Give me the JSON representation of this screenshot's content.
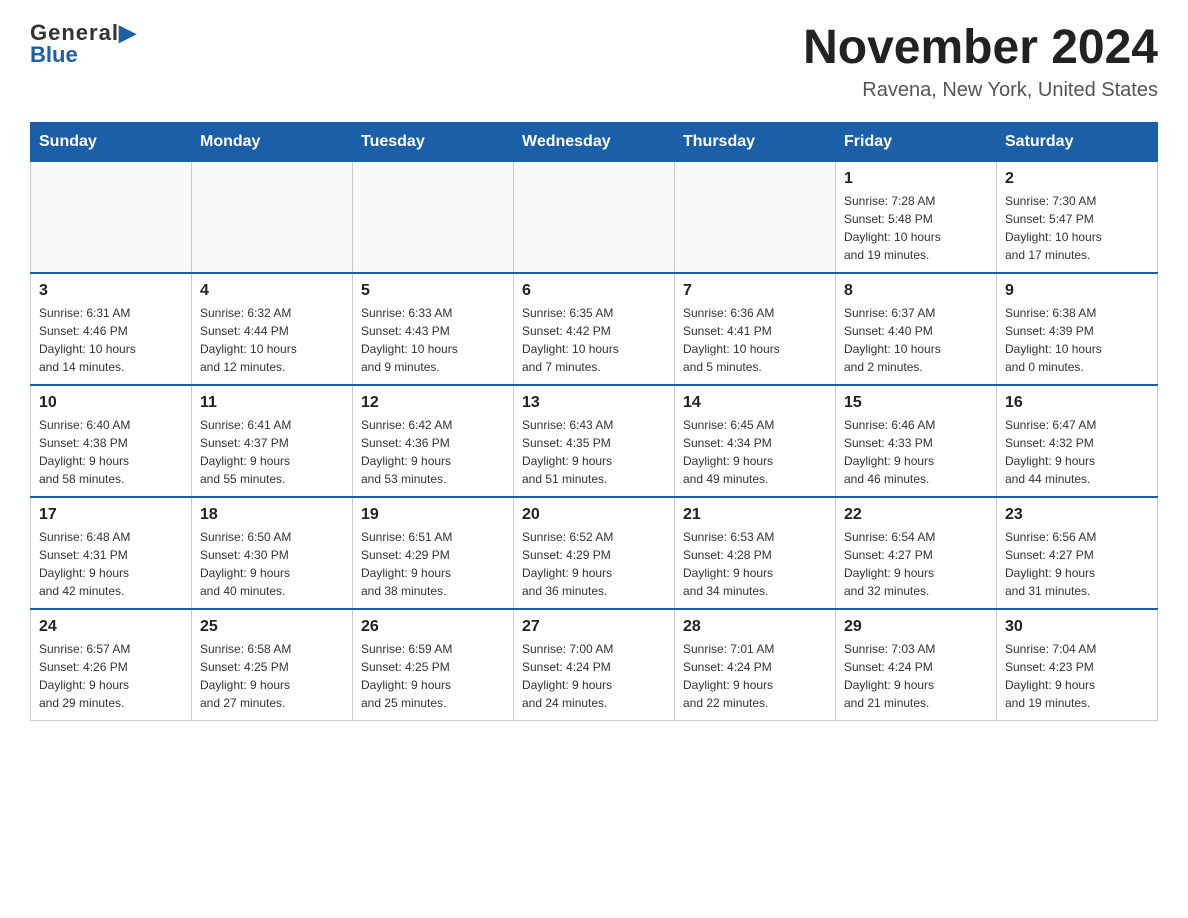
{
  "header": {
    "logo_general": "General",
    "logo_blue": "Blue",
    "month_title": "November 2024",
    "location": "Ravena, New York, United States"
  },
  "days_of_week": [
    "Sunday",
    "Monday",
    "Tuesday",
    "Wednesday",
    "Thursday",
    "Friday",
    "Saturday"
  ],
  "weeks": [
    [
      {
        "day": "",
        "info": ""
      },
      {
        "day": "",
        "info": ""
      },
      {
        "day": "",
        "info": ""
      },
      {
        "day": "",
        "info": ""
      },
      {
        "day": "",
        "info": ""
      },
      {
        "day": "1",
        "info": "Sunrise: 7:28 AM\nSunset: 5:48 PM\nDaylight: 10 hours\nand 19 minutes."
      },
      {
        "day": "2",
        "info": "Sunrise: 7:30 AM\nSunset: 5:47 PM\nDaylight: 10 hours\nand 17 minutes."
      }
    ],
    [
      {
        "day": "3",
        "info": "Sunrise: 6:31 AM\nSunset: 4:46 PM\nDaylight: 10 hours\nand 14 minutes."
      },
      {
        "day": "4",
        "info": "Sunrise: 6:32 AM\nSunset: 4:44 PM\nDaylight: 10 hours\nand 12 minutes."
      },
      {
        "day": "5",
        "info": "Sunrise: 6:33 AM\nSunset: 4:43 PM\nDaylight: 10 hours\nand 9 minutes."
      },
      {
        "day": "6",
        "info": "Sunrise: 6:35 AM\nSunset: 4:42 PM\nDaylight: 10 hours\nand 7 minutes."
      },
      {
        "day": "7",
        "info": "Sunrise: 6:36 AM\nSunset: 4:41 PM\nDaylight: 10 hours\nand 5 minutes."
      },
      {
        "day": "8",
        "info": "Sunrise: 6:37 AM\nSunset: 4:40 PM\nDaylight: 10 hours\nand 2 minutes."
      },
      {
        "day": "9",
        "info": "Sunrise: 6:38 AM\nSunset: 4:39 PM\nDaylight: 10 hours\nand 0 minutes."
      }
    ],
    [
      {
        "day": "10",
        "info": "Sunrise: 6:40 AM\nSunset: 4:38 PM\nDaylight: 9 hours\nand 58 minutes."
      },
      {
        "day": "11",
        "info": "Sunrise: 6:41 AM\nSunset: 4:37 PM\nDaylight: 9 hours\nand 55 minutes."
      },
      {
        "day": "12",
        "info": "Sunrise: 6:42 AM\nSunset: 4:36 PM\nDaylight: 9 hours\nand 53 minutes."
      },
      {
        "day": "13",
        "info": "Sunrise: 6:43 AM\nSunset: 4:35 PM\nDaylight: 9 hours\nand 51 minutes."
      },
      {
        "day": "14",
        "info": "Sunrise: 6:45 AM\nSunset: 4:34 PM\nDaylight: 9 hours\nand 49 minutes."
      },
      {
        "day": "15",
        "info": "Sunrise: 6:46 AM\nSunset: 4:33 PM\nDaylight: 9 hours\nand 46 minutes."
      },
      {
        "day": "16",
        "info": "Sunrise: 6:47 AM\nSunset: 4:32 PM\nDaylight: 9 hours\nand 44 minutes."
      }
    ],
    [
      {
        "day": "17",
        "info": "Sunrise: 6:48 AM\nSunset: 4:31 PM\nDaylight: 9 hours\nand 42 minutes."
      },
      {
        "day": "18",
        "info": "Sunrise: 6:50 AM\nSunset: 4:30 PM\nDaylight: 9 hours\nand 40 minutes."
      },
      {
        "day": "19",
        "info": "Sunrise: 6:51 AM\nSunset: 4:29 PM\nDaylight: 9 hours\nand 38 minutes."
      },
      {
        "day": "20",
        "info": "Sunrise: 6:52 AM\nSunset: 4:29 PM\nDaylight: 9 hours\nand 36 minutes."
      },
      {
        "day": "21",
        "info": "Sunrise: 6:53 AM\nSunset: 4:28 PM\nDaylight: 9 hours\nand 34 minutes."
      },
      {
        "day": "22",
        "info": "Sunrise: 6:54 AM\nSunset: 4:27 PM\nDaylight: 9 hours\nand 32 minutes."
      },
      {
        "day": "23",
        "info": "Sunrise: 6:56 AM\nSunset: 4:27 PM\nDaylight: 9 hours\nand 31 minutes."
      }
    ],
    [
      {
        "day": "24",
        "info": "Sunrise: 6:57 AM\nSunset: 4:26 PM\nDaylight: 9 hours\nand 29 minutes."
      },
      {
        "day": "25",
        "info": "Sunrise: 6:58 AM\nSunset: 4:25 PM\nDaylight: 9 hours\nand 27 minutes."
      },
      {
        "day": "26",
        "info": "Sunrise: 6:59 AM\nSunset: 4:25 PM\nDaylight: 9 hours\nand 25 minutes."
      },
      {
        "day": "27",
        "info": "Sunrise: 7:00 AM\nSunset: 4:24 PM\nDaylight: 9 hours\nand 24 minutes."
      },
      {
        "day": "28",
        "info": "Sunrise: 7:01 AM\nSunset: 4:24 PM\nDaylight: 9 hours\nand 22 minutes."
      },
      {
        "day": "29",
        "info": "Sunrise: 7:03 AM\nSunset: 4:24 PM\nDaylight: 9 hours\nand 21 minutes."
      },
      {
        "day": "30",
        "info": "Sunrise: 7:04 AM\nSunset: 4:23 PM\nDaylight: 9 hours\nand 19 minutes."
      }
    ]
  ]
}
